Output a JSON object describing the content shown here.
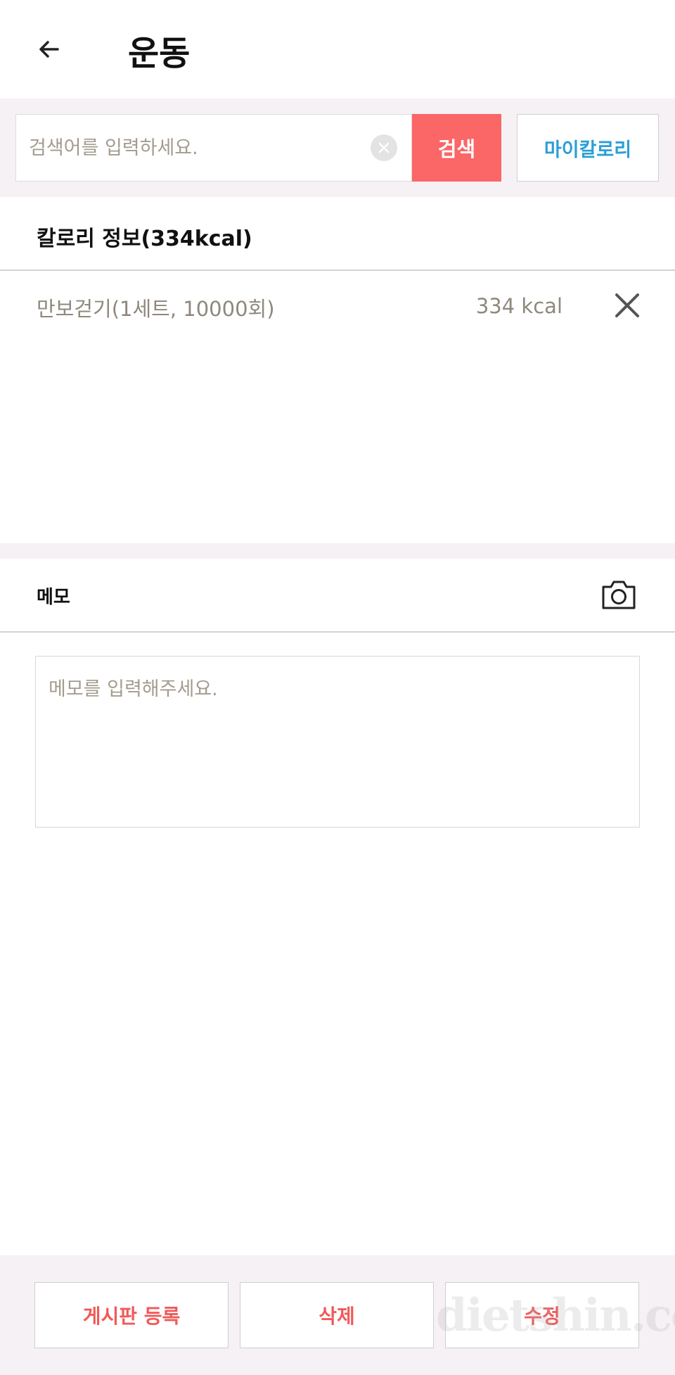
{
  "header": {
    "title": "운동",
    "back_icon": "arrow-left-icon"
  },
  "search": {
    "placeholder": "검색어를 입력하세요.",
    "clear_icon": "clear-circle-icon",
    "button_label": "검색",
    "my_calorie_label": "마이칼로리"
  },
  "calorie": {
    "title": "칼로리 정보(334kcal)",
    "items": [
      {
        "name": "만보걷기(1세트, 10000회)",
        "kcal": "334 kcal",
        "remove_icon": "close-icon"
      }
    ]
  },
  "memo": {
    "title": "메모",
    "camera_icon": "camera-icon",
    "placeholder": "메모를 입력해주세요."
  },
  "actions": {
    "post_label": "게시판 등록",
    "delete_label": "삭제",
    "edit_label": "수정"
  },
  "watermark": "dietshin.com",
  "colors": {
    "accent_red": "#fb6666",
    "accent_blue": "#2a9fd6",
    "band_bg": "#f6f1f4"
  }
}
